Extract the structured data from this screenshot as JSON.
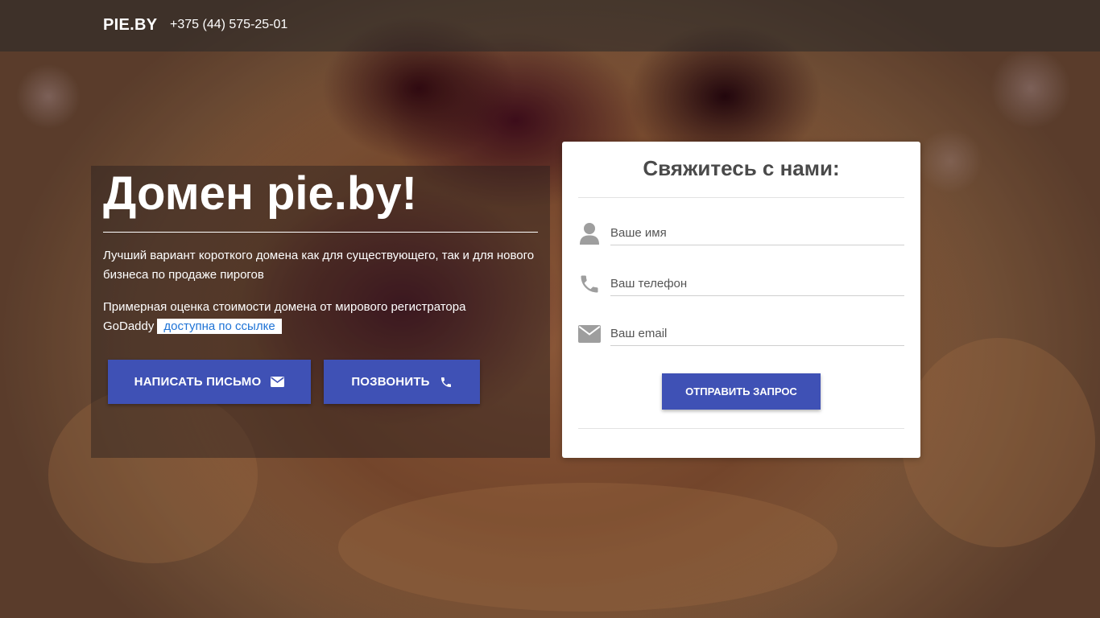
{
  "header": {
    "brand": "PIE.BY",
    "phone": "+375 (44) 575-25-01"
  },
  "hero": {
    "title": "Домен pie.by!",
    "description": "Лучший вариант короткого домена как для существующего, так и для нового бизнеса по продаже пирогов",
    "estimate_text": "Примерная оценка стоимости домена от мирового регистратора GoDaddy",
    "estimate_link": "доступна по ссылке",
    "buttons": {
      "mail_label": "НАПИСАТЬ ПИСЬМО",
      "mail_icon": "envelope-icon",
      "call_label": "ПОЗВОНИТЬ",
      "call_icon": "phone-icon"
    }
  },
  "contact_form": {
    "title": "Свяжитесь с нами:",
    "fields": {
      "name_placeholder": "Ваше имя",
      "name_icon": "user-icon",
      "phone_placeholder": "Ваш телефон",
      "phone_icon": "phone-icon",
      "email_placeholder": "Ваш email",
      "email_icon": "envelope-icon"
    },
    "submit_label": "ОТПРАВИТЬ ЗАПРОС"
  },
  "colors": {
    "accent": "#3f51b5",
    "link": "#1e73d6",
    "icon_gray": "#9e9e9e"
  }
}
